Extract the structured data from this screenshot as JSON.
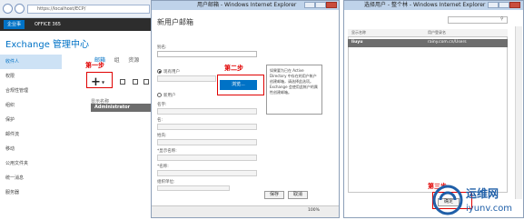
{
  "eac": {
    "address": "https://localhost/ECP/",
    "user_badge": "企业事",
    "brand": "OFFICE 365",
    "title": "Exchange 管理中心",
    "side_items": [
      "收件人",
      "权限",
      "合规性管理",
      "组织",
      "保护",
      "邮件流",
      "移动",
      "公用文件夹",
      "统一消息",
      "服务器"
    ],
    "tabs": [
      "邮箱",
      "组",
      "资源"
    ],
    "plus": "+",
    "grid_header": "显示名称",
    "grid_row": "Administrator",
    "step1": "第一步"
  },
  "new_mailbox": {
    "window_title": "用户邮箱 - Windows Internet Explorer",
    "heading": "新用户邮箱",
    "alias_label": "别名:",
    "existing_user": "现有用户",
    "browse": "浏览...",
    "new_user": "新用户",
    "first_name": "名字:",
    "initials": "名:",
    "last_name": "姓氏:",
    "display_name": "*显示名称:",
    "name": "*名称:",
    "org_unit": "组织单位:",
    "step2": "第二步",
    "tooltip": "如果要为已在 Active Directory 中存在的用户帐户创建邮箱，请选择此选项。Exchange 会使用此帐户的属性创建邮箱。",
    "save": "保存",
    "cancel": "取消",
    "zoom": "100%"
  },
  "select_user": {
    "window_title": "选择用户 - 整个林 - Windows Internet Explorer",
    "col_display": "显示名称",
    "col_upn": "用户登录名",
    "row_name": "liuyu",
    "row_upn": "rainy.com.cn/Users",
    "ok": "确定",
    "cancel": "取消",
    "step3": "第三步"
  },
  "watermark": {
    "cn": "运维网",
    "en": "iyunv.com"
  }
}
